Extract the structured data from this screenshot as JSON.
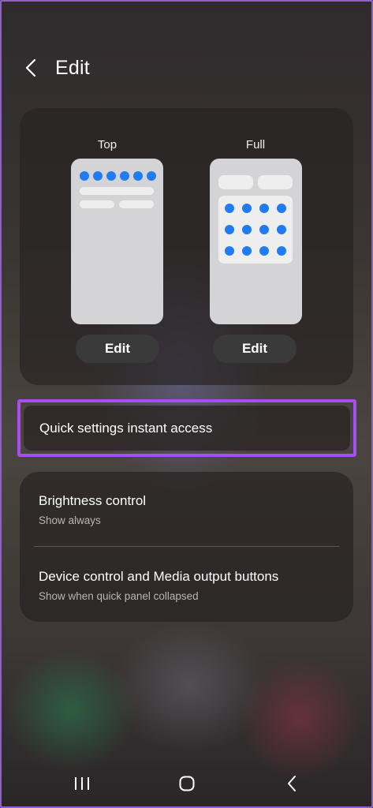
{
  "header": {
    "title": "Edit",
    "back_icon": "chevron-left-icon"
  },
  "preview": {
    "top": {
      "label": "Top",
      "edit_label": "Edit"
    },
    "full": {
      "label": "Full",
      "edit_label": "Edit"
    }
  },
  "instant_access": {
    "label": "Quick settings instant access"
  },
  "settings": {
    "brightness": {
      "title": "Brightness control",
      "subtitle": "Show always"
    },
    "device_control": {
      "title": "Device control and Media output buttons",
      "subtitle": "Show when quick panel collapsed"
    }
  },
  "navbar": {
    "recents_icon": "recents-icon",
    "home_icon": "home-icon",
    "back_icon": "back-icon"
  },
  "colors": {
    "accent_blue": "#1f7cf2",
    "highlight_purple": "#a64ef0"
  }
}
